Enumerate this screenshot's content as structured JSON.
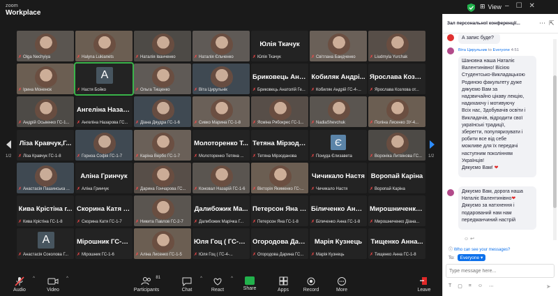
{
  "app": {
    "logo_top": "zoom",
    "logo_main": "Workplace",
    "view_label": "View"
  },
  "gallery": {
    "page_left": "1/2",
    "page_right": "1/2",
    "rows": [
      [
        {
          "name": "Olga Nechyiya",
          "type": "video"
        },
        {
          "name": "Halyna Lukianets",
          "type": "video"
        },
        {
          "name": "Наталія Іванченко",
          "type": "video"
        },
        {
          "name": "Наталія Єльченко",
          "type": "video"
        },
        {
          "name": "Юлія Ткачук",
          "type": "text",
          "big": "Юлія Ткачук"
        },
        {
          "name": "Світлана Бандченко",
          "type": "video"
        },
        {
          "name": "Liudmyla Yurchak",
          "type": "video"
        }
      ],
      [
        {
          "name": "Ірина Моненок",
          "type": "video"
        },
        {
          "name": "Настя Бойко",
          "type": "avatar",
          "letter": "A",
          "active": true
        },
        {
          "name": "Ольга Тищенко",
          "type": "video"
        },
        {
          "name": "Віта Цирульнік",
          "type": "video"
        },
        {
          "name": "Бриковець Анатолій Ге...",
          "type": "text",
          "big": "Бриковець Ана..."
        },
        {
          "name": "Кобиляк Андрій ГС-4-...",
          "type": "text",
          "big": "Кобиляк Андрі..."
        },
        {
          "name": "Ярослава Козлова от...",
          "type": "text",
          "big": "Ярослава Козл..."
        }
      ],
      [
        {
          "name": "Андрій Осьвенко ГС-1...",
          "type": "video"
        },
        {
          "name": "Ангеліна Назарова ГС...",
          "type": "text",
          "big": "Ангеліна Назар..."
        },
        {
          "name": "Діана Дяудра ГС-1-6",
          "type": "video"
        },
        {
          "name": "Сивко Марина ГС-1-8",
          "type": "video"
        },
        {
          "name": "Ясміна Рябокрес ГС-1...",
          "type": "video"
        },
        {
          "name": "NadiaShevchuk",
          "type": "video"
        },
        {
          "name": "Поліна Лисенко ЗУ-4...",
          "type": "video"
        }
      ],
      [
        {
          "name": "Ліза Кравчук ГС-1-8",
          "type": "text",
          "big": "Ліза Кравчук,Г..."
        },
        {
          "name": "Горноа Софія ГС-1-7",
          "type": "video"
        },
        {
          "name": "Каріна Вербо ГС-1-7",
          "type": "video"
        },
        {
          "name": "Молоторенко Тетяна ...",
          "type": "text",
          "big": "Молоторенко Т..."
        },
        {
          "name": "Тетяна Мірзоданова",
          "type": "text",
          "big": "Тетяна Мірзода..."
        },
        {
          "name": "Понуда Єлизавета",
          "type": "avatarE",
          "letter": "Є"
        },
        {
          "name": "Вороніка Литвінова ГС...",
          "type": "video"
        }
      ],
      [
        {
          "name": "Анастасія Пашинська ...",
          "type": "video"
        },
        {
          "name": "Аліна Гринчук",
          "type": "text",
          "big": "Аліна Гринчук"
        },
        {
          "name": "Дарина Гончарова ГС...",
          "type": "video"
        },
        {
          "name": "Коновал Назарій ГС-1-6",
          "type": "video"
        },
        {
          "name": "Вікторія Якименко ГС-...",
          "type": "video"
        },
        {
          "name": "Чичикало Настя",
          "type": "text",
          "big": "Чичикало Настя"
        },
        {
          "name": "Воропай Каріна",
          "type": "text",
          "big": "Воропай Каріна"
        }
      ],
      [
        {
          "name": "Кива Крістіна ГС-1-8",
          "type": "text",
          "big": "Кива Крістіна г..."
        },
        {
          "name": "Скорина Катя ГС-1-7",
          "type": "text",
          "big": "Скорина Катя Г..."
        },
        {
          "name": "Никита Павлов ГС-2-7",
          "type": "video"
        },
        {
          "name": "Далибожик Марічка Г...",
          "type": "text",
          "big": "Далибожик Ма..."
        },
        {
          "name": "Петерсон Яна ГС-1-8",
          "type": "text",
          "big": "Петерсон Яна Г..."
        },
        {
          "name": "Біличенко Анна ГС-1-8",
          "type": "text",
          "big": "Біличенко Анна..."
        },
        {
          "name": "Мирошниченко Діана...",
          "type": "text",
          "big": "Мирошниченко..."
        }
      ],
      [
        {
          "name": "Анастасія Соколова Г...",
          "type": "avatar",
          "letter": "A"
        },
        {
          "name": "Мірошник ГС-1-6",
          "type": "text",
          "big": "Мірошник ГС-1-6"
        },
        {
          "name": "Аліна Лисенко ГС-1-5",
          "type": "video"
        },
        {
          "name": "Юля Гоц ( ГС-4-...",
          "type": "text",
          "big": "Юля Гоц ( ГС-4-..."
        },
        {
          "name": "Огородова Дарина ГС...",
          "type": "text",
          "big": "Огородова Дар..."
        },
        {
          "name": "Марія Кузнець",
          "type": "text",
          "big": "Марія Кузнець"
        },
        {
          "name": "Тищенко Анна ГС-1-8",
          "type": "text",
          "big": "Тищенко Анна..."
        }
      ]
    ]
  },
  "toolbar": {
    "items": [
      {
        "key": "audio",
        "label": "Audio"
      },
      {
        "key": "video",
        "label": "Video"
      },
      {
        "key": "participants",
        "label": "Participants",
        "count": "81"
      },
      {
        "key": "chat",
        "label": "Chat"
      },
      {
        "key": "react",
        "label": "React"
      },
      {
        "key": "share",
        "label": "Share"
      },
      {
        "key": "apps",
        "label": "Apps"
      },
      {
        "key": "record",
        "label": "Record"
      },
      {
        "key": "more",
        "label": "More"
      },
      {
        "key": "leave",
        "label": "Leave"
      }
    ]
  },
  "chat": {
    "title": "Зал персональної конференції...",
    "q_bubble": "А запис буде?",
    "msg1": {
      "sender": "Віта Цирульник",
      "to_label": "to",
      "recipient": "Everyone",
      "time": "4:51",
      "lines": [
        "Шановна наша Наталіє",
        "Валентинівно! Вісією",
        "Студентсько-Викладацькою",
        "Родиною факультету дуже",
        "дякуємо Вам за",
        "надзвичайно цікаву лекцію,",
        "надихаючу і мотивуючу",
        "Всіх нас, Здобувачів освіти і",
        "Викладачів, відродити свої",
        "українські традиції,",
        "зберегти, популяризувати і",
        "робити все від себе",
        "можливе для їх передачі",
        "наступним поколінням",
        "Українців!"
      ],
      "closing": "Дякуємо Вам!"
    },
    "msg2": {
      "lines": [
        "Дякуємо Вам, дорога наша",
        "Наталіє Валентинівно",
        "Дякуємо за натхнення і",
        "подарований нам нам",
        "передманчиний настрій"
      ]
    },
    "who_sees": "Who can see your messages?",
    "to_field_label": "To:",
    "to_field_value": "Everyone",
    "input_placeholder": "Type message here..."
  },
  "colors": {
    "accent": "#0e71eb",
    "mute": "#ff4b4b",
    "share": "#22b14c",
    "active_tile": "#3ab54a"
  }
}
